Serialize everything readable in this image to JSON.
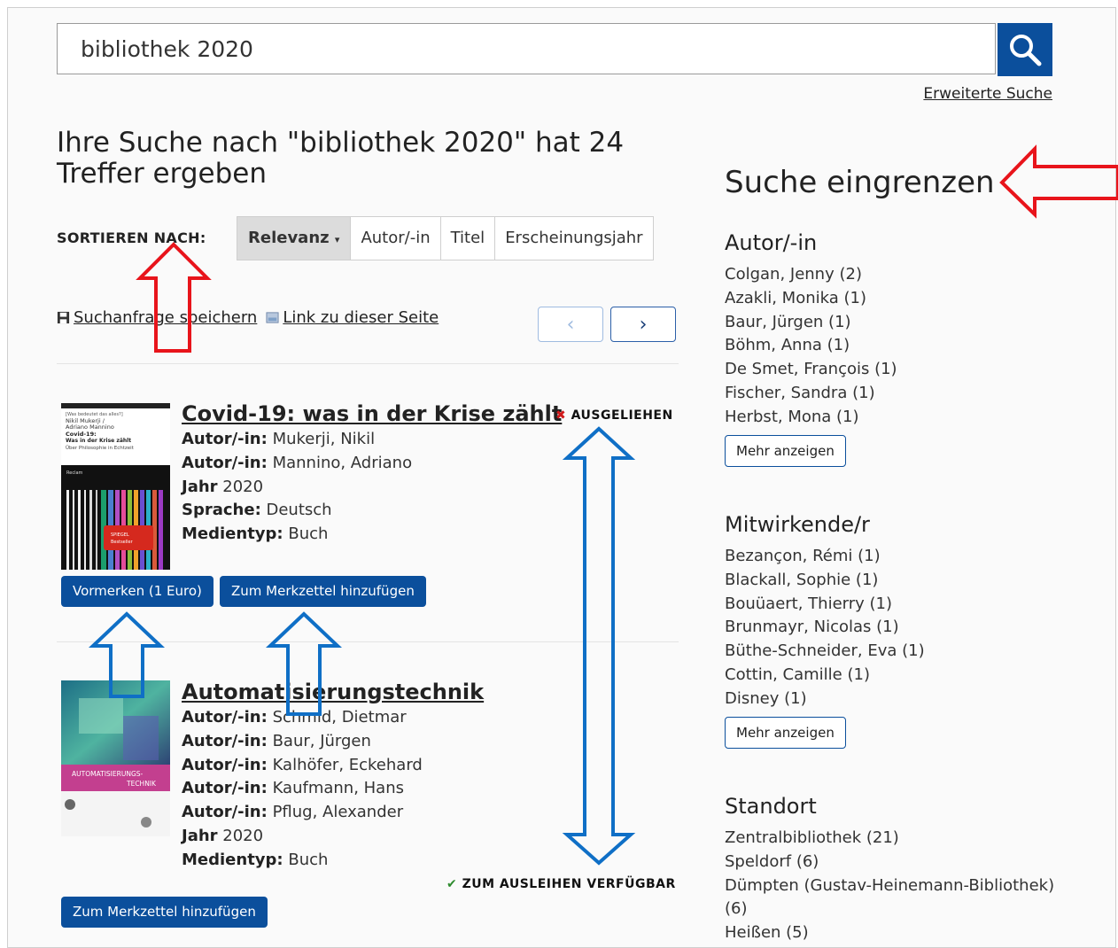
{
  "search": {
    "value": "bibliothek 2020",
    "advanced_link": "Erweiterte Suche"
  },
  "results": {
    "headline": "Ihre Suche nach \"bibliothek 2020\" hat 24 Treffer ergeben",
    "sort_label": "SORTIEREN NACH:",
    "sort_options": [
      "Relevanz",
      "Autor/-in",
      "Titel",
      "Erscheinungsjahr"
    ],
    "save_query": "Suchanfrage speichern",
    "page_link": "Link zu dieser Seite",
    "pager_prev": "‹",
    "pager_next": "›",
    "items": [
      {
        "title": "Covid-19: was in der Krise zählt",
        "status_icon": "✖",
        "status": "AUSGELIEHEN",
        "cover_lines": [
          "[Was bedeutet das alles?]",
          "Nikil Mukerji /",
          "Adriano Mannino",
          "Covid-19:",
          "Was in der Krise zählt",
          "Über Philosophie in Echtzeit",
          "Reclam",
          "SPIEGEL",
          "Bestseller"
        ],
        "meta": [
          {
            "label": "Autor/-in:",
            "value": "Mukerji, Nikil"
          },
          {
            "label": "Autor/-in:",
            "value": "Mannino, Adriano"
          },
          {
            "label": "Jahr",
            "value": "2020"
          },
          {
            "label": "Sprache:",
            "value": "Deutsch"
          },
          {
            "label": "Medientyp:",
            "value": "Buch"
          }
        ],
        "btn_reserve": "Vormerken (1 Euro)",
        "btn_watchlist": "Zum Merkzettel hinzufügen"
      },
      {
        "title": "Automatisierungstechnik",
        "status_icon": "✔",
        "status": "ZUM AUSLEIHEN VERFÜGBAR",
        "cover_lines": [
          "AUTOMATISIERUNGS-",
          "TECHNIK"
        ],
        "meta": [
          {
            "label": "Autor/-in:",
            "value": "Schmid, Dietmar"
          },
          {
            "label": "Autor/-in:",
            "value": "Baur, Jürgen"
          },
          {
            "label": "Autor/-in:",
            "value": "Kalhöfer, Eckehard"
          },
          {
            "label": "Autor/-in:",
            "value": "Kaufmann, Hans"
          },
          {
            "label": "Autor/-in:",
            "value": "Pflug, Alexander"
          },
          {
            "label": "Jahr",
            "value": "2020"
          },
          {
            "label": "Medientyp:",
            "value": "Buch"
          }
        ],
        "btn_watchlist": "Zum Merkzettel hinzufügen"
      }
    ]
  },
  "facets": {
    "title": "Suche eingrenzen",
    "groups": [
      {
        "name": "Autor/-in",
        "items": [
          "Colgan, Jenny (2)",
          "Azakli, Monika (1)",
          "Baur, Jürgen (1)",
          "Böhm, Anna (1)",
          "De Smet, François (1)",
          "Fischer, Sandra (1)",
          "Herbst, Mona (1)"
        ],
        "more": "Mehr anzeigen"
      },
      {
        "name": "Mitwirkende/r",
        "items": [
          "Bezançon, Rémi (1)",
          "Blackall, Sophie (1)",
          "Bouüaert, Thierry (1)",
          "Brunmayr, Nicolas (1)",
          "Büthe-Schneider, Eva (1)",
          "Cottin, Camille (1)",
          "Disney (1)"
        ],
        "more": "Mehr anzeigen"
      },
      {
        "name": "Standort",
        "items": [
          "Zentralbibliothek (21)",
          "Speldorf (6)",
          "Dümpten (Gustav-Heinemann-Bibliothek)",
          "(6)",
          "Heißen (5)"
        ]
      }
    ]
  },
  "colors": {
    "primary": "#0b4f9c",
    "annotation_red": "#e8141b",
    "annotation_blue": "#0f6fc6"
  },
  "icons": [
    "search-icon",
    "floppy-disk-icon",
    "link-image-icon",
    "chevron-left-icon",
    "chevron-right-icon",
    "cross-icon",
    "check-icon"
  ]
}
